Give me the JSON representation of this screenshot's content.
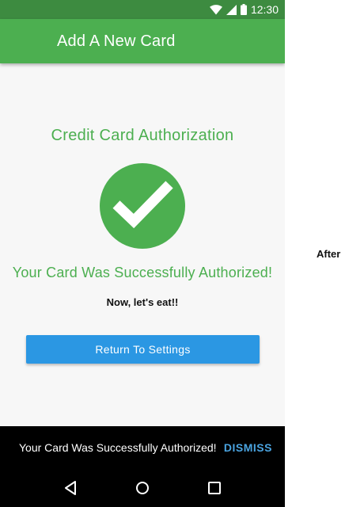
{
  "status_bar": {
    "time": "12:30",
    "icons": [
      "wifi-icon",
      "signal-icon",
      "battery-icon"
    ]
  },
  "app_bar": {
    "title": "Add A New Card"
  },
  "main": {
    "heading": "Credit Card Authorization",
    "check_icon": "check-circle-icon",
    "success_message": "Your Card Was Successfully Authorized!",
    "sub_message": "Now, let's eat!!",
    "return_button_label": "Return To Settings"
  },
  "snackbar": {
    "message": "Your Card Was Successfully Authorized!",
    "action_label": "DISMISS"
  },
  "nav_bar": {
    "buttons": [
      "back-icon",
      "home-icon",
      "recents-icon"
    ]
  },
  "annotation": {
    "label": "After"
  },
  "colors": {
    "primary": "#4caf50",
    "primary_dark": "#3d8b40",
    "button": "#2b97e3",
    "snackbar_action": "#4aa3df"
  }
}
